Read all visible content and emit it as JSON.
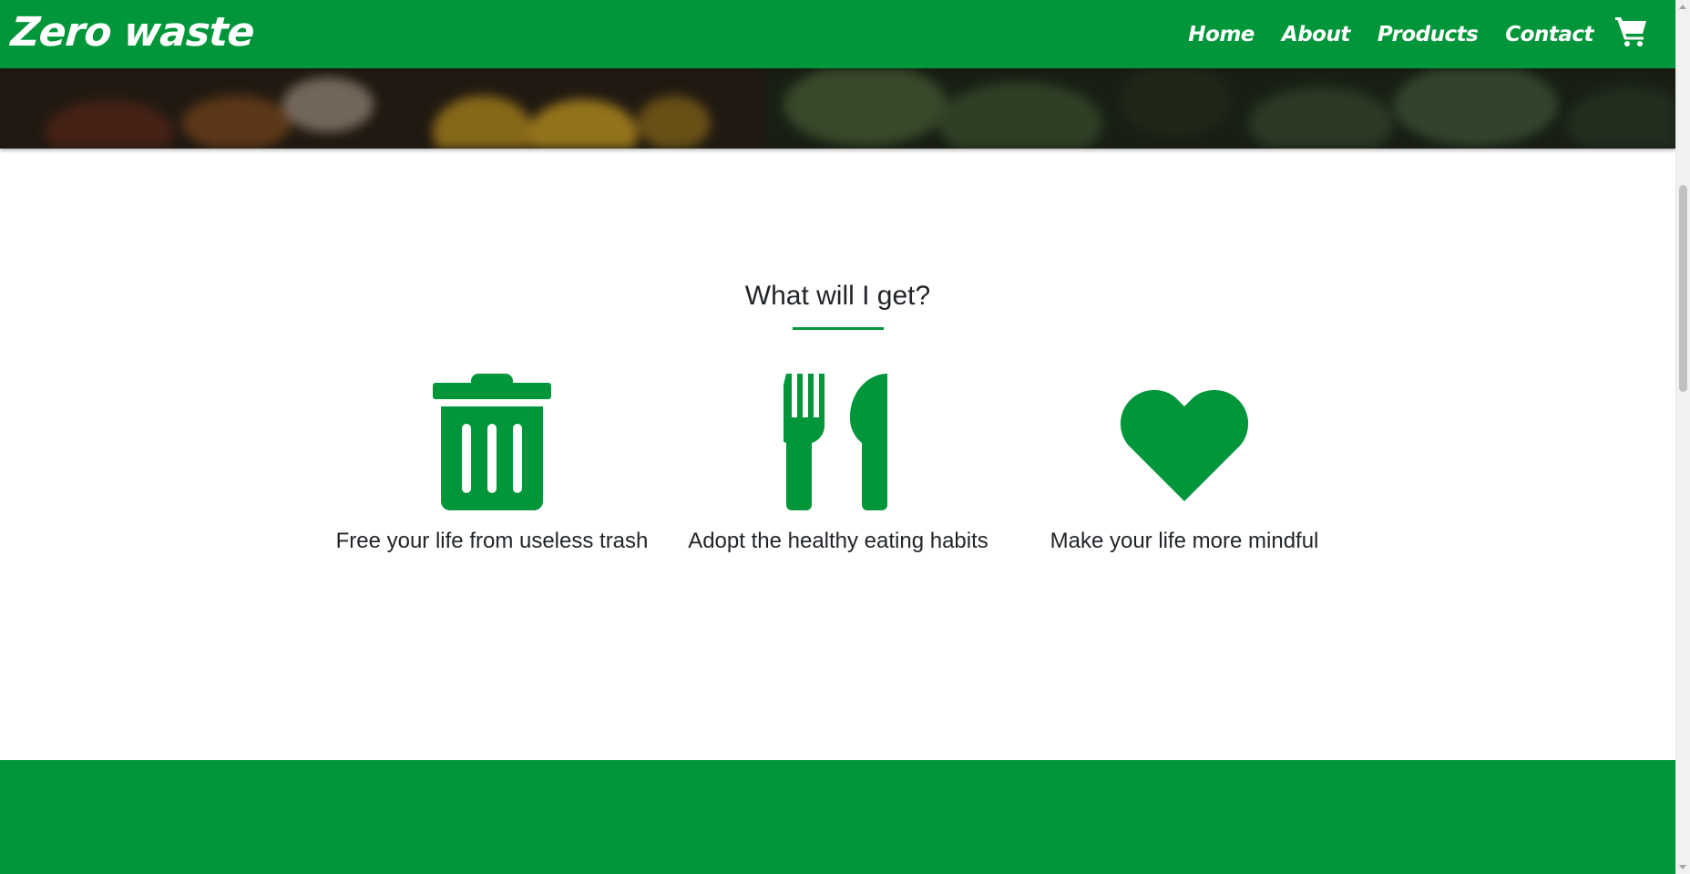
{
  "navbar": {
    "brand": "Zero waste",
    "links": [
      {
        "label": "Home"
      },
      {
        "label": "About"
      },
      {
        "label": "Products"
      },
      {
        "label": "Contact"
      }
    ],
    "cart_icon": "shopping-cart-icon"
  },
  "section": {
    "title": "What will I get?",
    "features": [
      {
        "icon": "trash-icon",
        "label": "Free your life from useless trash"
      },
      {
        "icon": "utensils-icon",
        "label": "Adopt the healthy eating habits"
      },
      {
        "icon": "heart-icon",
        "label": "Make your life more mindful"
      }
    ]
  },
  "colors": {
    "brand_green": "#009639",
    "text": "#212529",
    "background": "#ffffff"
  }
}
